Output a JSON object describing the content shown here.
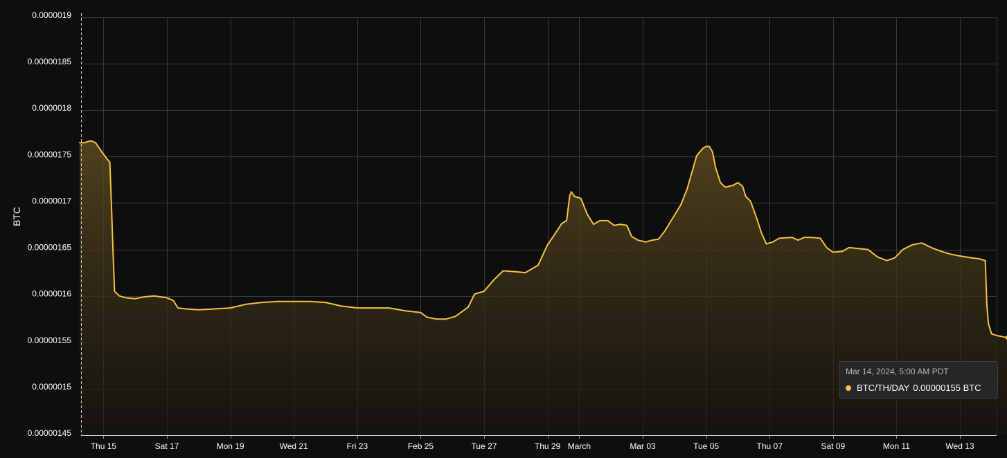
{
  "colors": {
    "background": "#0e0e0e",
    "line": "#f5c242",
    "fill_top": "#5c4a1f",
    "grid": "#3a3a3a",
    "text": "#ffffff"
  },
  "chart_data": {
    "type": "area",
    "ylabel": "BTC",
    "ylim": [
      1.45e-06,
      1.9e-06
    ],
    "y_ticks": [
      "0.0000019",
      "0.00000185",
      "0.0000018",
      "0.00000175",
      "0.0000017",
      "0.00000165",
      "0.0000016",
      "0.00000155",
      "0.0000015",
      "0.00000145"
    ],
    "y_tick_values": [
      1.9e-06,
      1.85e-06,
      1.8e-06,
      1.75e-06,
      1.7e-06,
      1.65e-06,
      1.6e-06,
      1.55e-06,
      1.5e-06,
      1.45e-06
    ],
    "x_ticks": [
      {
        "label": "Thu 15",
        "day": 1
      },
      {
        "label": "Sat 17",
        "day": 3
      },
      {
        "label": "Mon 19",
        "day": 5
      },
      {
        "label": "Wed 21",
        "day": 7
      },
      {
        "label": "Fri 23",
        "day": 9
      },
      {
        "label": "Feb 25",
        "day": 11
      },
      {
        "label": "Tue 27",
        "day": 13
      },
      {
        "label": "Thu 29",
        "day": 15
      },
      {
        "label": "March",
        "day": 16
      },
      {
        "label": "Mar 03",
        "day": 18
      },
      {
        "label": "Tue 05",
        "day": 20
      },
      {
        "label": "Thu 07",
        "day": 22
      },
      {
        "label": "Sat 09",
        "day": 24
      },
      {
        "label": "Mon 11",
        "day": 26
      },
      {
        "label": "Wed 13",
        "day": 28
      }
    ],
    "x_range_days": [
      0.25,
      29.5
    ],
    "grid": true,
    "series": [
      {
        "name": "BTC/TH/DAY",
        "points": [
          [
            0.25,
            1.765e-06
          ],
          [
            0.4,
            1.765e-06
          ],
          [
            0.6,
            1.767e-06
          ],
          [
            0.75,
            1.765e-06
          ],
          [
            0.95,
            1.755e-06
          ],
          [
            1.1,
            1.748e-06
          ],
          [
            1.2,
            1.744e-06
          ],
          [
            1.25,
            1.7e-06
          ],
          [
            1.3,
            1.65e-06
          ],
          [
            1.35,
            1.605e-06
          ],
          [
            1.5,
            1.6e-06
          ],
          [
            1.7,
            1.598e-06
          ],
          [
            2.0,
            1.597e-06
          ],
          [
            2.3,
            1.599e-06
          ],
          [
            2.6,
            1.6e-06
          ],
          [
            3.0,
            1.598e-06
          ],
          [
            3.2,
            1.595e-06
          ],
          [
            3.35,
            1.587e-06
          ],
          [
            3.6,
            1.586e-06
          ],
          [
            4.0,
            1.585e-06
          ],
          [
            4.5,
            1.586e-06
          ],
          [
            5.0,
            1.587e-06
          ],
          [
            5.5,
            1.591e-06
          ],
          [
            6.0,
            1.593e-06
          ],
          [
            6.5,
            1.594e-06
          ],
          [
            7.0,
            1.594e-06
          ],
          [
            7.5,
            1.594e-06
          ],
          [
            8.0,
            1.593e-06
          ],
          [
            8.5,
            1.589e-06
          ],
          [
            9.0,
            1.587e-06
          ],
          [
            9.5,
            1.587e-06
          ],
          [
            10.0,
            1.587e-06
          ],
          [
            10.5,
            1.584e-06
          ],
          [
            11.0,
            1.582e-06
          ],
          [
            11.2,
            1.577e-06
          ],
          [
            11.5,
            1.575e-06
          ],
          [
            11.8,
            1.575e-06
          ],
          [
            12.1,
            1.578e-06
          ],
          [
            12.5,
            1.588e-06
          ],
          [
            12.7,
            1.602e-06
          ],
          [
            13.0,
            1.605e-06
          ],
          [
            13.3,
            1.617e-06
          ],
          [
            13.6,
            1.627e-06
          ],
          [
            14.0,
            1.626e-06
          ],
          [
            14.3,
            1.625e-06
          ],
          [
            14.7,
            1.633e-06
          ],
          [
            15.0,
            1.655e-06
          ],
          [
            15.2,
            1.665e-06
          ],
          [
            15.45,
            1.678e-06
          ],
          [
            15.6,
            1.681e-06
          ],
          [
            15.7,
            1.708e-06
          ],
          [
            15.75,
            1.712e-06
          ],
          [
            15.85,
            1.707e-06
          ],
          [
            16.05,
            1.705e-06
          ],
          [
            16.25,
            1.688e-06
          ],
          [
            16.45,
            1.677e-06
          ],
          [
            16.65,
            1.681e-06
          ],
          [
            16.9,
            1.681e-06
          ],
          [
            17.1,
            1.676e-06
          ],
          [
            17.3,
            1.677e-06
          ],
          [
            17.5,
            1.676e-06
          ],
          [
            17.65,
            1.664e-06
          ],
          [
            17.85,
            1.66e-06
          ],
          [
            18.1,
            1.658e-06
          ],
          [
            18.3,
            1.66e-06
          ],
          [
            18.5,
            1.661e-06
          ],
          [
            18.7,
            1.67e-06
          ],
          [
            18.95,
            1.684e-06
          ],
          [
            19.2,
            1.698e-06
          ],
          [
            19.4,
            1.715e-06
          ],
          [
            19.55,
            1.733e-06
          ],
          [
            19.7,
            1.751e-06
          ],
          [
            19.9,
            1.759e-06
          ],
          [
            20.0,
            1.761e-06
          ],
          [
            20.1,
            1.761e-06
          ],
          [
            20.2,
            1.755e-06
          ],
          [
            20.3,
            1.738e-06
          ],
          [
            20.45,
            1.722e-06
          ],
          [
            20.6,
            1.717e-06
          ],
          [
            20.85,
            1.719e-06
          ],
          [
            21.0,
            1.722e-06
          ],
          [
            21.15,
            1.718e-06
          ],
          [
            21.25,
            1.707e-06
          ],
          [
            21.4,
            1.702e-06
          ],
          [
            21.6,
            1.683e-06
          ],
          [
            21.75,
            1.667e-06
          ],
          [
            21.9,
            1.656e-06
          ],
          [
            22.1,
            1.658e-06
          ],
          [
            22.3,
            1.662e-06
          ],
          [
            22.7,
            1.663e-06
          ],
          [
            22.9,
            1.66e-06
          ],
          [
            23.1,
            1.663e-06
          ],
          [
            23.3,
            1.663e-06
          ],
          [
            23.6,
            1.662e-06
          ],
          [
            23.8,
            1.652e-06
          ],
          [
            24.0,
            1.647e-06
          ],
          [
            24.3,
            1.648e-06
          ],
          [
            24.5,
            1.652e-06
          ],
          [
            24.8,
            1.651e-06
          ],
          [
            25.1,
            1.65e-06
          ],
          [
            25.4,
            1.642e-06
          ],
          [
            25.7,
            1.638e-06
          ],
          [
            25.95,
            1.641e-06
          ],
          [
            26.2,
            1.65e-06
          ],
          [
            26.5,
            1.655e-06
          ],
          [
            26.8,
            1.657e-06
          ],
          [
            27.1,
            1.652e-06
          ],
          [
            27.4,
            1.648e-06
          ],
          [
            27.7,
            1.645e-06
          ],
          [
            28.0,
            1.643e-06
          ],
          [
            28.35,
            1.641e-06
          ],
          [
            28.6,
            1.64e-06
          ],
          [
            28.8,
            1.638e-06
          ],
          [
            28.85,
            1.59e-06
          ],
          [
            28.9,
            1.57e-06
          ],
          [
            29.0,
            1.559e-06
          ],
          [
            29.2,
            1.557e-06
          ],
          [
            29.35,
            1.556e-06
          ],
          [
            29.5,
            1.555e-06
          ]
        ]
      }
    ]
  },
  "tooltip": {
    "time": "Mar 14, 2024, 5:00 AM PDT",
    "series_name": "BTC/TH/DAY",
    "value": "0.00000155 BTC"
  }
}
